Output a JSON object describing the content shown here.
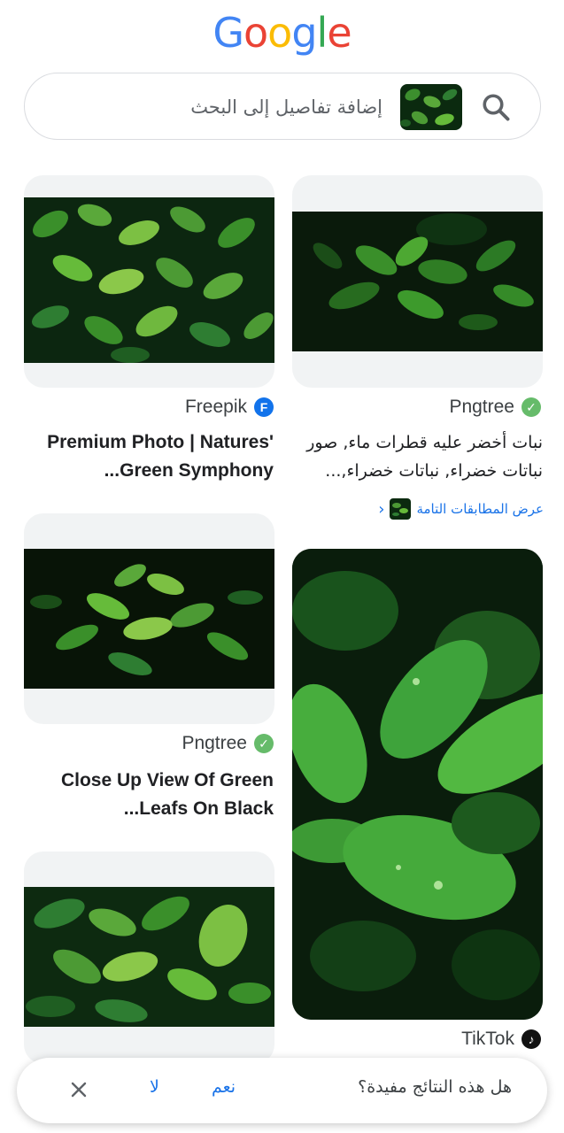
{
  "logo": {
    "letters": [
      "G",
      "o",
      "o",
      "g",
      "l",
      "e"
    ],
    "colors": [
      "#4285F4",
      "#EA4335",
      "#FBBC05",
      "#4285F4",
      "#34A853",
      "#EA4335"
    ]
  },
  "search": {
    "placeholder": "إضافة تفاصيل إلى البحث",
    "icon": "search-icon",
    "query_image": "green-leaves-thumbnail"
  },
  "results": [
    {
      "source": "Pngtree",
      "source_icon": "pngtree-icon",
      "title": "نبات أخضر عليه قطرات ماء, صور نباتات خضراء, نباتات خضراء,..."
    },
    {
      "source": "Freepik",
      "source_icon": "freepik-icon",
      "title": "Premium Photo | Natures' Green Symphony..."
    },
    {
      "source": "Pngtree",
      "source_icon": "pngtree-icon",
      "title": "Close Up View Of Green Leafs On Black..."
    },
    {
      "source": "TikTok",
      "source_icon": "tiktok-icon",
      "title": ""
    }
  ],
  "exact_matches": {
    "label": "عرض المطابقات التامة"
  },
  "feedback": {
    "question": "هل هذه النتائج مفيدة؟",
    "yes": "نعم",
    "no": "لا"
  },
  "colors": {
    "accent": "#1a73e8",
    "leaf_dark": "#0b2a0f",
    "leaf_mid": "#2e7d32",
    "leaf_light": "#66bb3a"
  }
}
